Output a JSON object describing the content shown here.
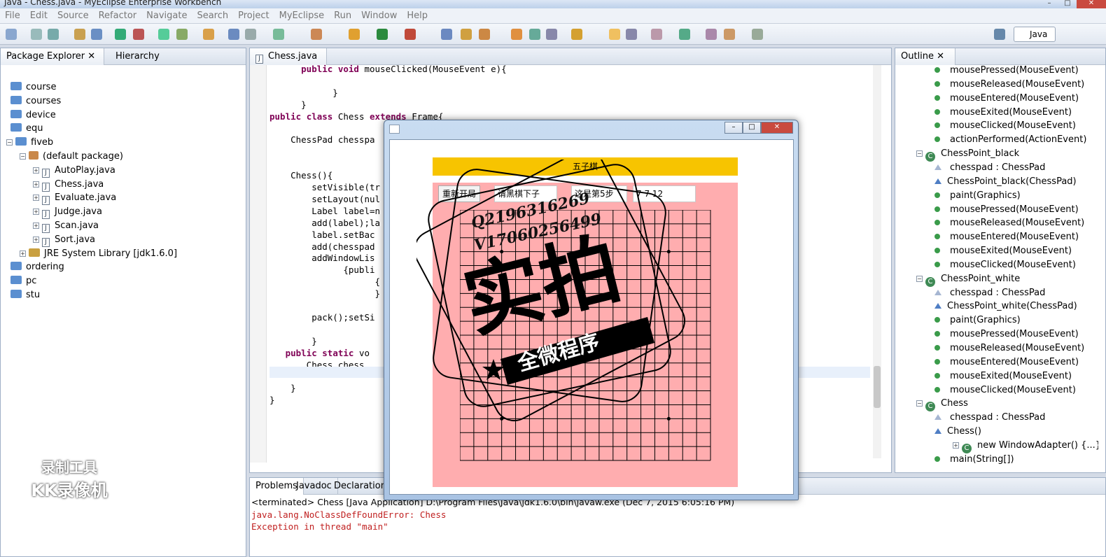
{
  "window": {
    "title": "Java - Chess.java - MyEclipse Enterprise Workbench"
  },
  "menu": [
    "File",
    "Edit",
    "Source",
    "Refactor",
    "Navigate",
    "Search",
    "Project",
    "MyEclipse",
    "Run",
    "Window",
    "Help"
  ],
  "perspective": {
    "label": "Java"
  },
  "package_explorer": {
    "tab_label": "Package Explorer",
    "hierarchy_tab": "Hierarchy",
    "items": [
      {
        "label": "course"
      },
      {
        "label": "courses"
      },
      {
        "label": "device"
      },
      {
        "label": "equ"
      },
      {
        "label": "fiveb"
      },
      {
        "label": "(default package)"
      },
      {
        "label": "AutoPlay.java"
      },
      {
        "label": "Chess.java"
      },
      {
        "label": "Evaluate.java"
      },
      {
        "label": "Judge.java"
      },
      {
        "label": "Scan.java"
      },
      {
        "label": "Sort.java"
      },
      {
        "label": "JRE System Library [jdk1.6.0]"
      },
      {
        "label": "ordering"
      },
      {
        "label": "pc"
      },
      {
        "label": "stu"
      }
    ]
  },
  "editor": {
    "tab_label": "Chess.java",
    "lines": [
      "      public void mouseClicked(MouseEvent e){",
      "",
      "            }",
      "      }",
      "public class Chess extends Frame{",
      "",
      "    ChessPad chesspa",
      "",
      "",
      "    Chess(){",
      "        setVisible(tr",
      "        setLayout(nul",
      "        Label label=n",
      "        add(label);la",
      "        label.setBac",
      "        add(chesspad",
      "        addWindowLis",
      "              {publi",
      "                    {",
      "                    }",
      "",
      "        pack();setSi",
      "",
      "        }",
      "   public static vo",
      "       Chess chess",
      "",
      "    }",
      "}"
    ]
  },
  "outline": {
    "tab_label": "Outline",
    "items": [
      {
        "label": "mousePressed(MouseEvent)"
      },
      {
        "label": "mouseReleased(MouseEvent)"
      },
      {
        "label": "mouseEntered(MouseEvent)"
      },
      {
        "label": "mouseExited(MouseEvent)"
      },
      {
        "label": "mouseClicked(MouseEvent)"
      },
      {
        "label": "actionPerformed(ActionEvent)"
      },
      {
        "label": "ChessPoint_black"
      },
      {
        "label": "chesspad : ChessPad"
      },
      {
        "label": "ChessPoint_black(ChessPad)"
      },
      {
        "label": "paint(Graphics)"
      },
      {
        "label": "mousePressed(MouseEvent)"
      },
      {
        "label": "mouseReleased(MouseEvent)"
      },
      {
        "label": "mouseEntered(MouseEvent)"
      },
      {
        "label": "mouseExited(MouseEvent)"
      },
      {
        "label": "mouseClicked(MouseEvent)"
      },
      {
        "label": "ChessPoint_white"
      },
      {
        "label": "chesspad : ChessPad"
      },
      {
        "label": "ChessPoint_white(ChessPad)"
      },
      {
        "label": "paint(Graphics)"
      },
      {
        "label": "mousePressed(MouseEvent)"
      },
      {
        "label": "mouseReleased(MouseEvent)"
      },
      {
        "label": "mouseEntered(MouseEvent)"
      },
      {
        "label": "mouseExited(MouseEvent)"
      },
      {
        "label": "mouseClicked(MouseEvent)"
      },
      {
        "label": "Chess"
      },
      {
        "label": "chesspad : ChessPad"
      },
      {
        "label": "Chess()"
      },
      {
        "label": "new WindowAdapter() {...}"
      },
      {
        "label": "main(String[])"
      }
    ]
  },
  "console": {
    "tabs": [
      "Problems",
      "Javadoc",
      "Declaration"
    ],
    "terminated": "<terminated> Chess [Java Application] D:\\Program Files\\Java\\jdk1.6.0\\bin\\javaw.exe (Dec 7, 2015 6:05:16 PM)",
    "lines": [
      "java.lang.NoClassDefFoundError: Chess",
      "Exception in thread \"main\""
    ]
  },
  "game_window": {
    "title_bar": "五子棋",
    "buttons": {
      "restart": "重新开局"
    },
    "fields": {
      "turn": "请黑棋下子",
      "step": "这是第5步",
      "coords": "7  7 12"
    },
    "grid": {
      "rows": 18,
      "cols": 18
    }
  },
  "stamp": {
    "qq": "Q2196316269",
    "v": "V17060256499",
    "main": "实拍",
    "banner": "全微程序"
  },
  "recorder_watermark": {
    "line1": "录制工具",
    "line2": "KK录像机"
  },
  "colors": {
    "board": "#ffadaf",
    "title_bar": "#f7c400",
    "error": "#c02020",
    "keyword": "#7f0055"
  }
}
